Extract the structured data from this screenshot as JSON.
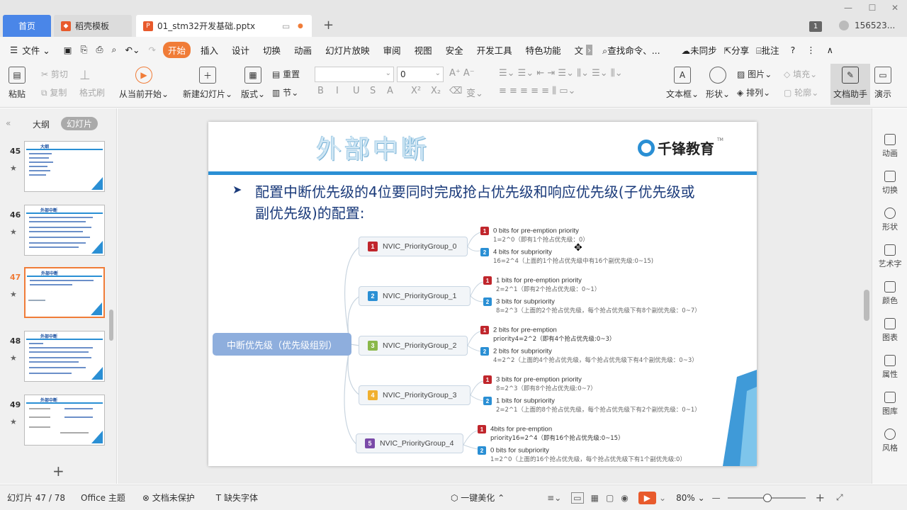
{
  "tabs": {
    "home": "首页",
    "template": "稻壳模板",
    "document": "01_stm32开发基础.pptx",
    "add": "+"
  },
  "window": {
    "badge": "1",
    "user": "156523..."
  },
  "menu": {
    "file": "文件",
    "items": [
      "开始",
      "插入",
      "设计",
      "切换",
      "动画",
      "幻灯片放映",
      "审阅",
      "视图",
      "安全",
      "开发工具",
      "特色功能",
      "文"
    ],
    "search": "查找命令、...",
    "sync": "未同步",
    "share": "分享",
    "comment": "批注"
  },
  "toolbar": {
    "paste": "粘贴",
    "cut": "剪切",
    "copy": "复制",
    "format_painter": "格式刷",
    "from_current": "从当前开始",
    "new_slide": "新建幻灯片",
    "layout": "版式",
    "reset": "重置",
    "section": "节",
    "font_size": "0",
    "textbox": "文本框",
    "shape": "形状",
    "picture": "图片",
    "fill": "填充",
    "arrange": "排列",
    "outline": "轮廓",
    "doc_helper": "文档助手",
    "present": "演示"
  },
  "left_panel": {
    "outline_tab": "大纲",
    "slides_tab": "幻灯片",
    "slides": [
      {
        "num": "45",
        "title": "大纲"
      },
      {
        "num": "46",
        "title": "外部中断"
      },
      {
        "num": "47",
        "title": "外部中断"
      },
      {
        "num": "48",
        "title": "外部中断"
      },
      {
        "num": "49",
        "title": "外部中断"
      }
    ],
    "add": "+"
  },
  "slide": {
    "title": "外部中断",
    "logo": "千锋教育",
    "tm": "TM",
    "bullet": "配置中断优先级的4位要同时完成抢占优先级和响应优先级(子优先级或副优先级)的配置:",
    "root": "中断优先级（优先级组别）",
    "groups": [
      {
        "n": "1",
        "color": "#c0262c",
        "name": "NVIC_PriorityGroup_0",
        "a": "0 bits for pre-emption priority",
        "a_sub": "1=2^0（即有1个抢占优先级：0）",
        "b": "4 bits for subpriority",
        "b_sub": "16=2^4（上面的1个抢占优先级中有16个副优先级:0~15)"
      },
      {
        "n": "2",
        "color": "#2a8fd4",
        "name": "NVIC_PriorityGroup_1",
        "a": "1 bits for pre-emption priority",
        "a_sub": "2=2^1（即有2个抢占优先级：0~1）",
        "b": "3 bits for subpriority",
        "b_sub": "8=2^3（上面的2个抢占优先级，每个抢占优先级下有8个副优先级：0~7）"
      },
      {
        "n": "3",
        "color": "#8ab84a",
        "name": "NVIC_PriorityGroup_2",
        "a": "2 bits for pre-emption",
        "a_sub": "priority4=2^2（即有4个抢占优先级:0~3）",
        "b": "2 bits for subpriority",
        "b_sub": "4=2^2（上面的4个抢占优先级，每个抢占优先级下有4个副优先级：0~3）"
      },
      {
        "n": "4",
        "color": "#f0b030",
        "name": "NVIC_PriorityGroup_3",
        "a": "3 bits for pre-emption priority",
        "a_sub": "8=2^3（即有8个抢占优先级:0~7）",
        "b": "1 bits for subpriority",
        "b_sub": "2=2^1（上面的8个抢占优先级，每个抢占优先级下有2个副优先级：0~1）"
      },
      {
        "n": "5",
        "color": "#7a4aa8",
        "name": "NVIC_PriorityGroup_4",
        "a": "4bits for pre-emption",
        "a_sub": "priority16=2^4（即有16个抢占优先级:0~15）",
        "b": "0 bits for subpriority",
        "b_sub": "1=2^0（上面的16个抢占优先级，每个抢占优先级下有1个副优先级:0）"
      }
    ]
  },
  "right_panel": [
    "动画",
    "切换",
    "形状",
    "艺术字",
    "颜色",
    "图表",
    "属性",
    "图库",
    "风格"
  ],
  "status": {
    "slide_pos": "幻灯片 47 / 78",
    "theme": "Office 主题",
    "protect": "文档未保护",
    "font_missing": "缺失字体",
    "beautify": "一键美化",
    "zoom": "80%"
  },
  "colors": {
    "accent": "#f07c38",
    "tab_home": "#4a86e8",
    "slide_blue": "#2a8fd4"
  }
}
